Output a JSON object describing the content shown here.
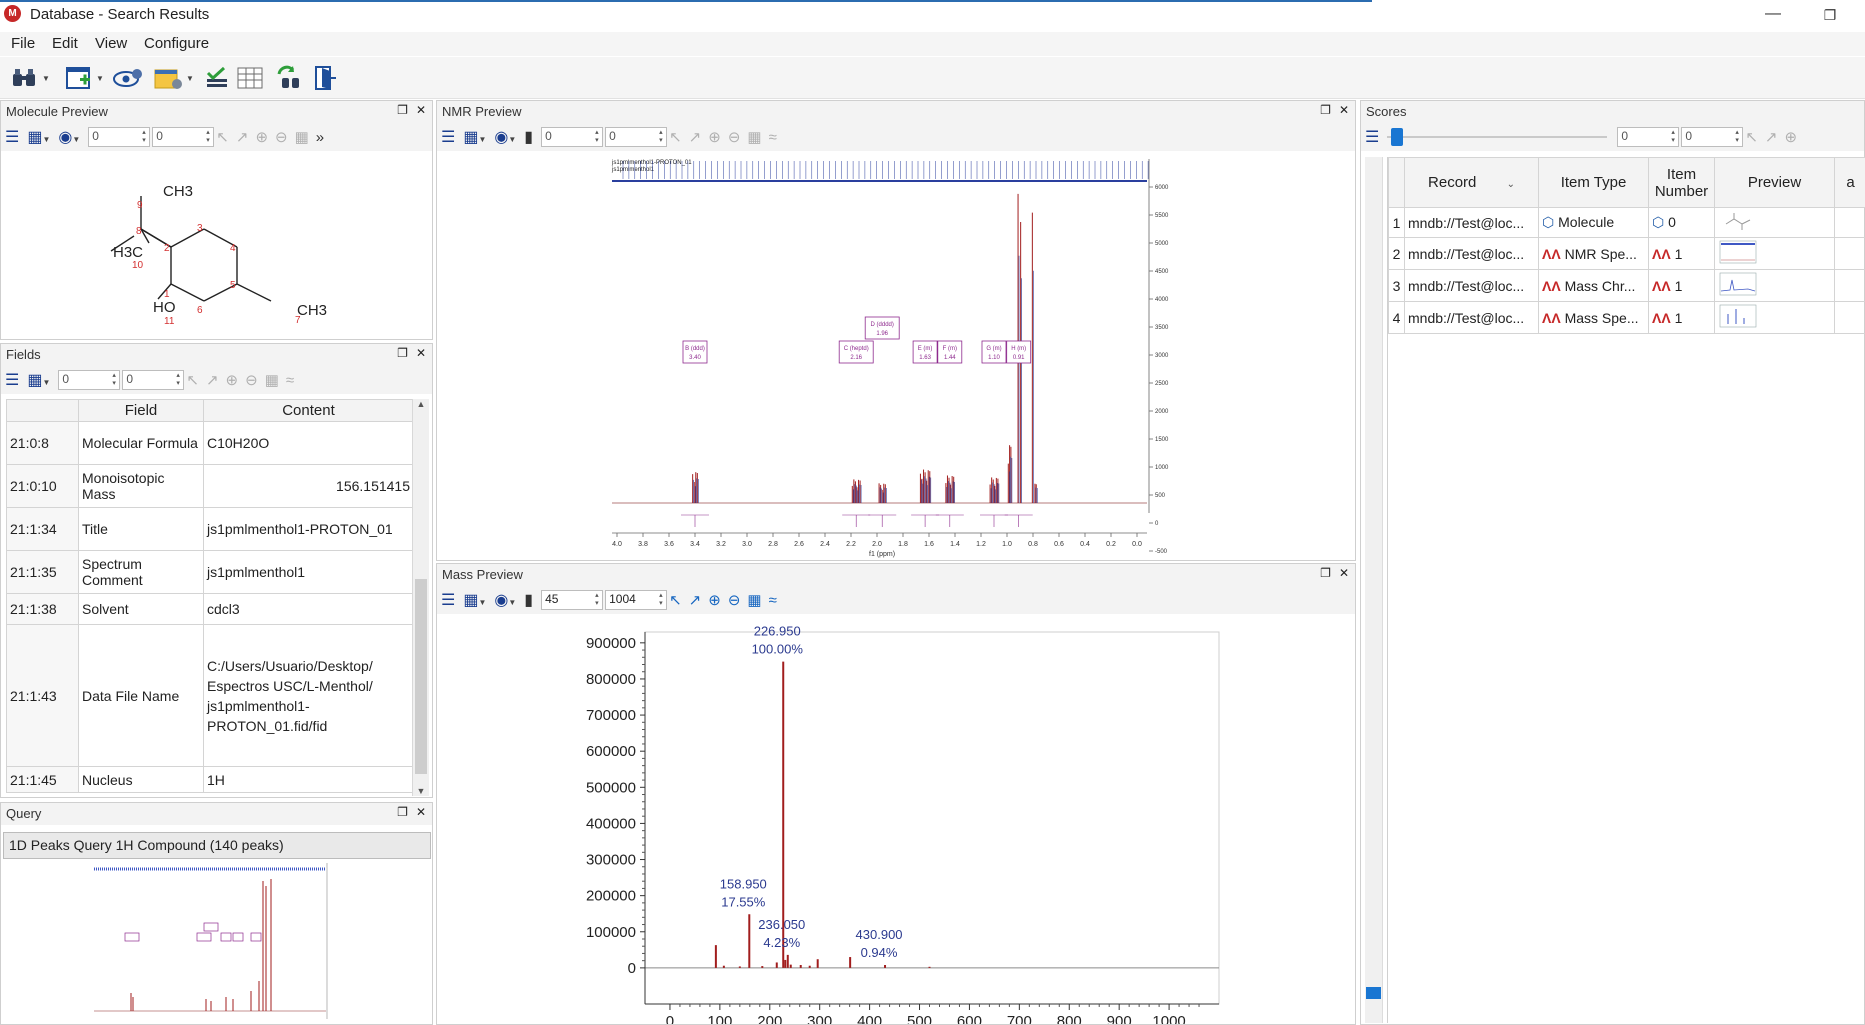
{
  "window": {
    "title": "Database - Search Results"
  },
  "menu": [
    "File",
    "Edit",
    "View",
    "Configure"
  ],
  "panels": {
    "molecule": "Molecule Preview",
    "fields": "Fields",
    "query": "Query",
    "nmr": "NMR Preview",
    "mass": "Mass Preview",
    "scores": "Scores"
  },
  "zoom_inputs": {
    "molecule": [
      "0",
      "0"
    ],
    "fields": [
      "0",
      "0"
    ],
    "nmr": [
      "0",
      "0"
    ],
    "mass": [
      "45",
      "1004"
    ],
    "scores": [
      "0",
      "0"
    ]
  },
  "molecule": {
    "groups": [
      "CH3",
      "H3C",
      "HO",
      "CH3"
    ],
    "atom_numbers": [
      "1",
      "2",
      "3",
      "4",
      "5",
      "6",
      "7",
      "8",
      "9",
      "10",
      "11"
    ]
  },
  "fields": {
    "columns": [
      "Field",
      "Content"
    ],
    "rows": [
      {
        "id": "21:0:8",
        "field": "Molecular Formula",
        "content": "C10H20O"
      },
      {
        "id": "21:0:10",
        "field": "Monoisotopic Mass",
        "content": "156.151415"
      },
      {
        "id": "21:1:34",
        "field": "Title",
        "content": "js1pmlmenthol1-PROTON_01"
      },
      {
        "id": "21:1:35",
        "field": "Spectrum Comment",
        "content": "js1pmlmenthol1"
      },
      {
        "id": "21:1:38",
        "field": "Solvent",
        "content": "cdcl3"
      },
      {
        "id": "21:1:43",
        "field": "Data File Name",
        "content": "C:/Users/Usuario/Desktop/ Espectros USC/L-Menthol/ js1pmlmenthol1- PROTON_01.fid/fid"
      },
      {
        "id": "21:1:45",
        "field": "Nucleus",
        "content": "1H"
      }
    ]
  },
  "query": {
    "label": "1D Peaks Query 1H Compound (140 peaks)"
  },
  "nmr": {
    "labels": [
      "js1pmlmenthol1-PROTON_01",
      "js1pmlmenthol1"
    ],
    "xlabel": "f1 (ppm)",
    "x_ticks": [
      "4.0",
      "3.8",
      "3.6",
      "3.4",
      "3.2",
      "3.0",
      "2.8",
      "2.6",
      "2.4",
      "2.2",
      "2.0",
      "1.8",
      "1.6",
      "1.4",
      "1.2",
      "1.0",
      "0.8",
      "0.6",
      "0.4",
      "0.2",
      "0.0"
    ],
    "y_ticks": [
      "6000",
      "5500",
      "5000",
      "4500",
      "4000",
      "3500",
      "3000",
      "2500",
      "2000",
      "1500",
      "1000",
      "500",
      "0",
      "-500"
    ],
    "multiplets": [
      {
        "name": "B (ddd)",
        "shift": "3.40"
      },
      {
        "name": "C (heptd)",
        "shift": "2.16"
      },
      {
        "name": "D (dddd)",
        "shift": "1.96"
      },
      {
        "name": "E (m)",
        "shift": "1.63"
      },
      {
        "name": "F (m)",
        "shift": "1.44"
      },
      {
        "name": "G (m)",
        "shift": "1.10"
      },
      {
        "name": "H (m)",
        "shift": "0.91"
      }
    ]
  },
  "chart_data": {
    "type": "bar",
    "title": "",
    "xlabel": "",
    "ylabel": "",
    "xlim": [
      -50,
      1100
    ],
    "ylim": [
      -100000,
      930000
    ],
    "x_ticks": [
      0,
      100,
      200,
      300,
      400,
      500,
      600,
      700,
      800,
      900,
      1000
    ],
    "y_ticks": [
      0,
      100000,
      200000,
      300000,
      400000,
      500000,
      600000,
      700000,
      800000,
      900000
    ],
    "peaks": [
      {
        "x": 92,
        "y": 63000
      },
      {
        "x": 108,
        "y": 6000
      },
      {
        "x": 140,
        "y": 4000
      },
      {
        "x": 158.95,
        "y": 148500
      },
      {
        "x": 185,
        "y": 5000
      },
      {
        "x": 214,
        "y": 15000
      },
      {
        "x": 226.95,
        "y": 848000
      },
      {
        "x": 231,
        "y": 22000
      },
      {
        "x": 236.05,
        "y": 36000
      },
      {
        "x": 242,
        "y": 9000
      },
      {
        "x": 262,
        "y": 8000
      },
      {
        "x": 280,
        "y": 6000
      },
      {
        "x": 296,
        "y": 24000
      },
      {
        "x": 361,
        "y": 30000
      },
      {
        "x": 430.9,
        "y": 8000
      },
      {
        "x": 520,
        "y": 3000
      }
    ],
    "annotations": [
      {
        "x": 226.95,
        "y": 848000,
        "mz": "226.950",
        "pct": "100.00%"
      },
      {
        "x": 158.95,
        "y": 148500,
        "mz": "158.950",
        "pct": "17.55%"
      },
      {
        "x": 236.05,
        "y": 36000,
        "mz": "236.050",
        "pct": "4.23%"
      },
      {
        "x": 430.9,
        "y": 8000,
        "mz": "430.900",
        "pct": "0.94%"
      }
    ]
  },
  "scores": {
    "columns": [
      "Record",
      "Item Type",
      "Item Number",
      "Preview"
    ],
    "rows": [
      {
        "n": "1",
        "record": "mndb://Test@loc...",
        "type": "Molecule",
        "icon": "molecule-icon",
        "number": "0"
      },
      {
        "n": "2",
        "record": "mndb://Test@loc...",
        "type": "NMR Spe...",
        "icon": "spectrum-icon",
        "number": "1"
      },
      {
        "n": "3",
        "record": "mndb://Test@loc...",
        "type": "Mass Chr...",
        "icon": "spectrum-icon",
        "number": "1"
      },
      {
        "n": "4",
        "record": "mndb://Test@loc...",
        "type": "Mass Spe...",
        "icon": "spectrum-icon",
        "number": "1"
      }
    ]
  },
  "colors": {
    "spectrum": "#a11d1d",
    "nmr_blue": "#2a3f9e",
    "annotation": "#2b3a8f",
    "multiplet_box": "#8e2a8e",
    "accent": "#2b6cb0"
  }
}
